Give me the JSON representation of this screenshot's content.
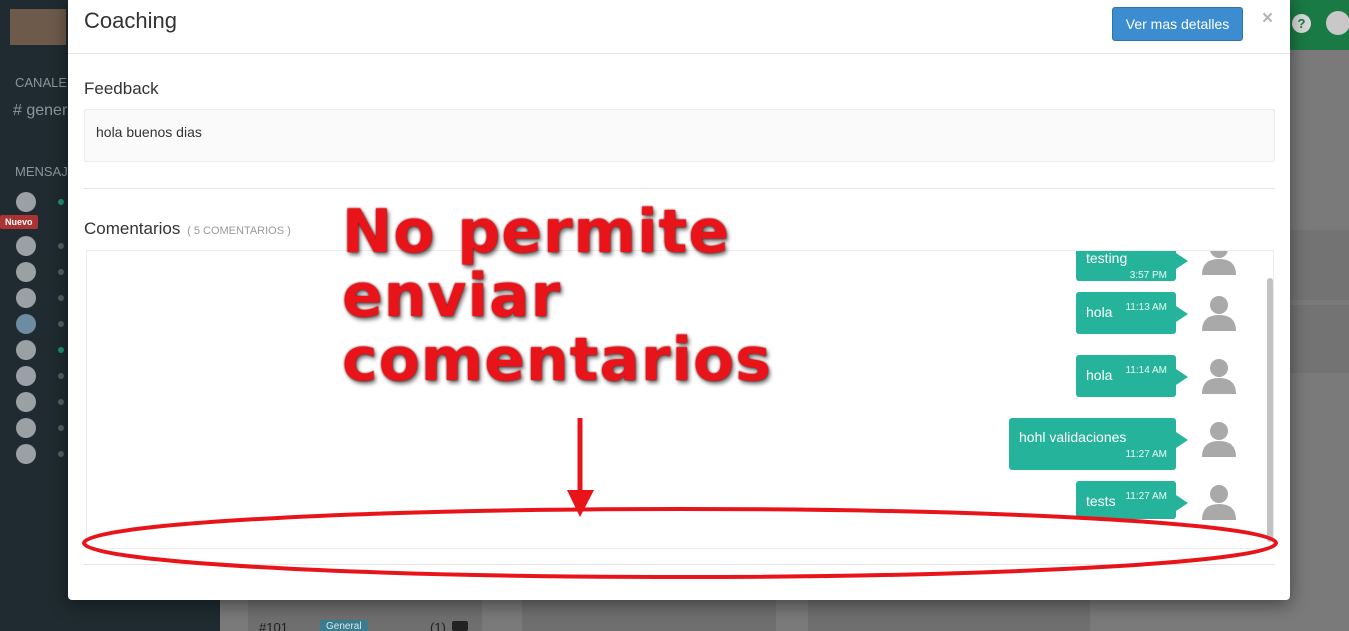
{
  "background": {
    "sidebar": {
      "channels_section": "CANALE",
      "channel_name": "# gener",
      "messages_section": "MENSAJ",
      "new_badge": "Nuevo"
    },
    "ticket_row": {
      "id": "#101",
      "tag": "General",
      "count": "(1)"
    },
    "help_icon": "?"
  },
  "modal": {
    "title": "Coaching",
    "details_button": "Ver mas detalles",
    "close_label": "×",
    "feedback": {
      "label": "Feedback",
      "text": "hola buenos dias"
    },
    "comments": {
      "label": "Comentarios",
      "count": "( 5 COMENTARIOS )",
      "messages": [
        {
          "text": "testing",
          "time": "3:57 PM"
        },
        {
          "text": "hola",
          "time": "11:13 AM"
        },
        {
          "text": "hola",
          "time": "11:14 AM"
        },
        {
          "text": "hohl validaciones",
          "time": "11:27 AM"
        },
        {
          "text": "tests",
          "time": "11:27 AM"
        }
      ]
    }
  },
  "annotation": {
    "lines": [
      "No permite",
      "enviar",
      "comentarios"
    ],
    "color": "#e8141a"
  }
}
